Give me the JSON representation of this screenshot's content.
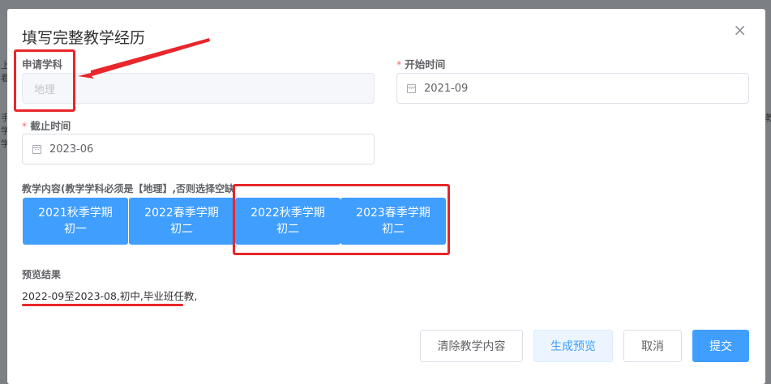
{
  "dialog": {
    "title": "填写完整教学经历",
    "close_icon": "×"
  },
  "form": {
    "subject": {
      "label": "申请学科",
      "value": "地理"
    },
    "start": {
      "required_mark": "*",
      "label": "开始时间",
      "value": "2021-09"
    },
    "end": {
      "required_mark": "*",
      "label": "截止时间",
      "value": "2023-06"
    },
    "content_label": "教学内容(教学学科必须是【地理】,否则选择空缺",
    "terms": [
      {
        "term": "2021秋季学期",
        "grade": "初一"
      },
      {
        "term": "2022春季学期",
        "grade": "初二"
      },
      {
        "term": "2022秋季学期",
        "grade": "初二"
      },
      {
        "term": "2023春季学期",
        "grade": "初二"
      }
    ],
    "preview_label": "预览结果",
    "preview_text": "2022-09至2023-08,初中,毕业班任教,"
  },
  "footer": {
    "clear_label": "清除教学内容",
    "preview_label": "生成预览",
    "cancel_label": "取消",
    "submit_label": "提交"
  },
  "background": {
    "fragments": [
      "上",
      "看",
      "手",
      "学",
      "学",
      "教"
    ]
  },
  "colors": {
    "primary": "#409eff",
    "annotation": "#e8262b",
    "required": "#f56c6c"
  }
}
